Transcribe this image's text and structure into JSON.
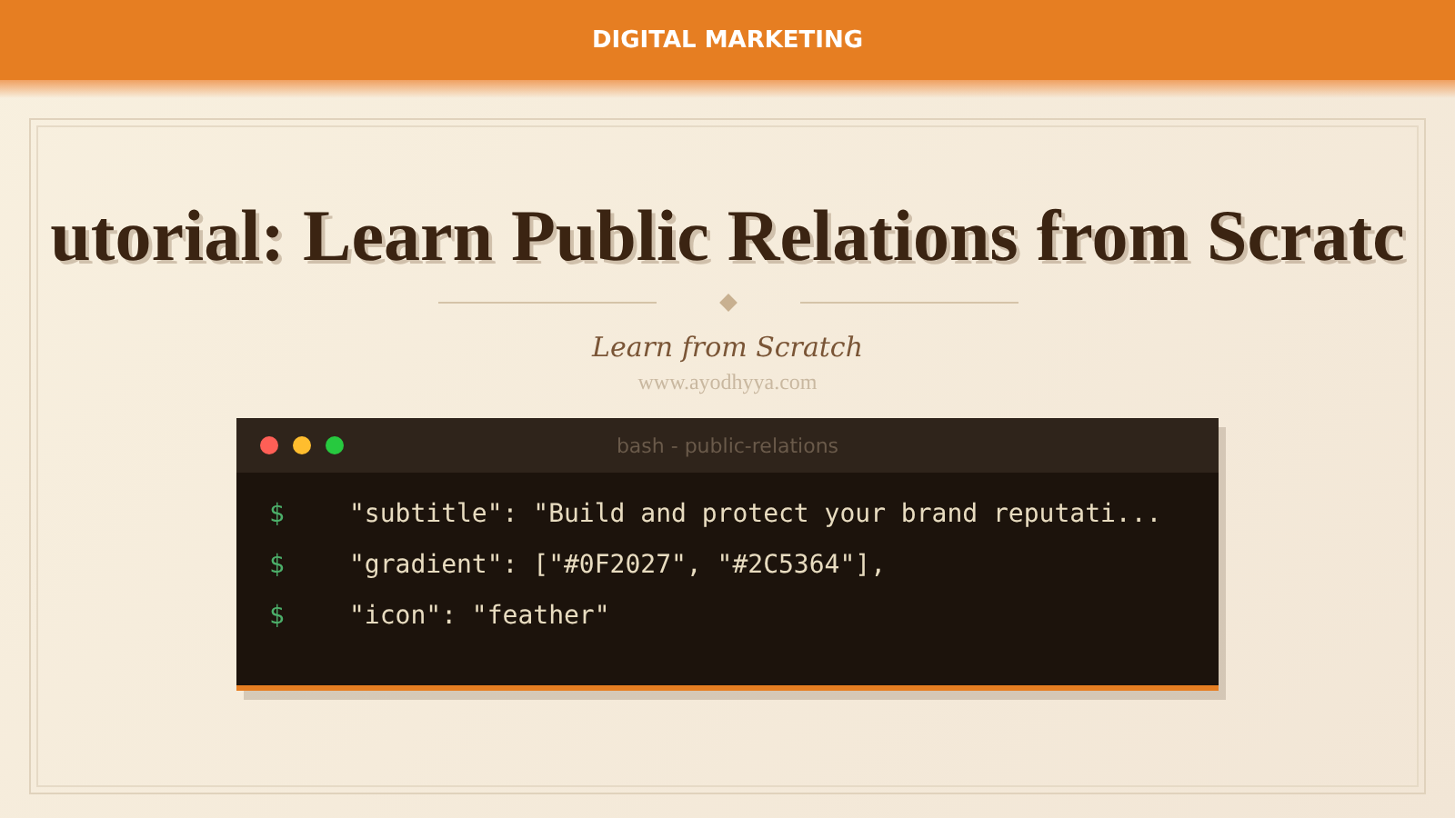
{
  "header": {
    "category": "DIGITAL MARKETING"
  },
  "hero": {
    "title": "utorial: Learn Public Relations from Scratc",
    "subtitle": "Learn from Scratch",
    "website": "www.ayodhyya.com"
  },
  "terminal": {
    "title": "bash - public-relations",
    "lines": [
      {
        "prompt": "$",
        "text": "\"subtitle\": \"Build and protect your brand reputati..."
      },
      {
        "prompt": "$",
        "text": "\"gradient\": [\"#0F2027\", \"#2C5364\"],"
      },
      {
        "prompt": "$",
        "text": "\"icon\": \"feather\""
      }
    ]
  }
}
